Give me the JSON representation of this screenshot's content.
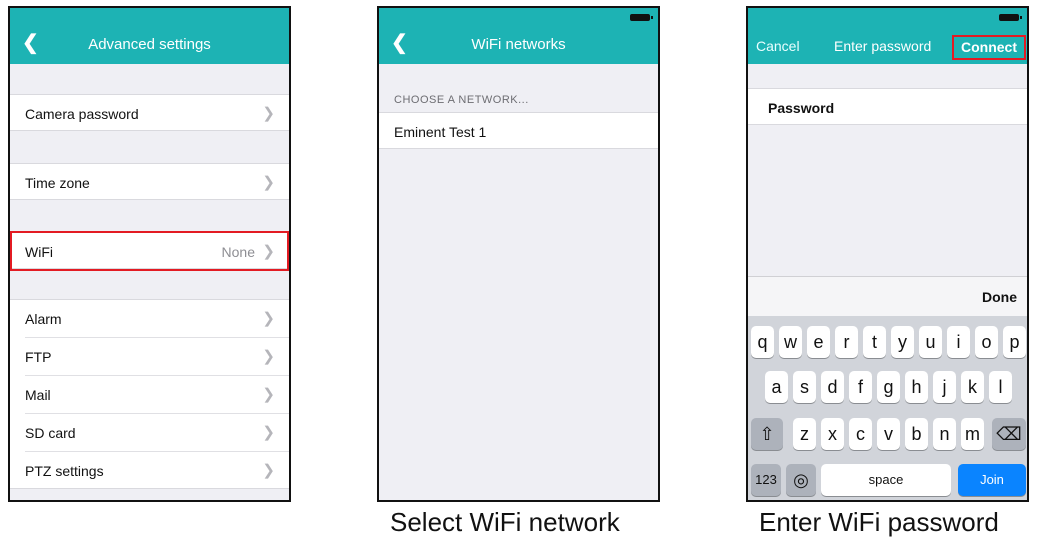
{
  "screen1": {
    "title": "Advanced settings",
    "items": [
      {
        "label": "Camera password",
        "value": ""
      },
      {
        "label": "Time zone",
        "value": ""
      },
      {
        "label": "WiFi",
        "value": "None"
      },
      {
        "label": "Alarm",
        "value": ""
      },
      {
        "label": "FTP",
        "value": ""
      },
      {
        "label": "Mail",
        "value": ""
      },
      {
        "label": "SD card",
        "value": ""
      },
      {
        "label": "PTZ settings",
        "value": ""
      }
    ]
  },
  "screen2": {
    "title": "WiFi networks",
    "section_header": "CHOOSE A NETWORK...",
    "networks": [
      {
        "label": "Eminent Test 1"
      }
    ],
    "caption": "Select WiFi network"
  },
  "screen3": {
    "cancel": "Cancel",
    "title": "Enter password",
    "connect": "Connect",
    "password_label": "Password",
    "done": "Done",
    "keyboard": {
      "row1": [
        "q",
        "w",
        "e",
        "r",
        "t",
        "y",
        "u",
        "i",
        "o",
        "p"
      ],
      "row2": [
        "a",
        "s",
        "d",
        "f",
        "g",
        "h",
        "j",
        "k",
        "l"
      ],
      "row3": [
        "z",
        "x",
        "c",
        "v",
        "b",
        "n",
        "m"
      ],
      "num": "123",
      "space": "space",
      "join": "Join"
    },
    "caption": "Enter WiFi password"
  },
  "icons": {
    "back": "chevron-left-icon",
    "chevron": "chevron-right-icon",
    "shift": "shift-icon",
    "delete": "backspace-icon",
    "globe": "globe-icon"
  },
  "colors": {
    "nav": "#1db3b4",
    "highlight": "#e31b23",
    "join": "#0a84ff"
  }
}
